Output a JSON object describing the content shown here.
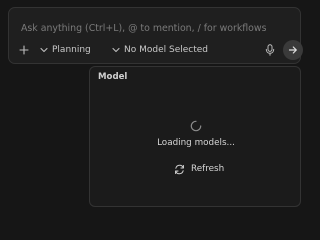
{
  "composer": {
    "placeholder": "Ask anything (Ctrl+L), @ to mention, / for workflows",
    "value": "",
    "mode_label": "Planning",
    "model_label": "No Model Selected",
    "icons": {
      "add": "plus-icon",
      "mode": "chevron-down-icon",
      "model": "chevron-down-icon",
      "mic": "microphone-icon",
      "send": "arrow-right-icon"
    }
  },
  "model_panel": {
    "title": "Model",
    "loading_text": "Loading models...",
    "refresh_label": "Refresh",
    "icons": {
      "spinner": "spinner-icon",
      "refresh": "refresh-icon"
    }
  },
  "colors": {
    "background": "#161616",
    "surface": "#1f1f1f",
    "border": "#333333",
    "text": "#d6d6d6",
    "muted_text": "#7a7a7a"
  }
}
